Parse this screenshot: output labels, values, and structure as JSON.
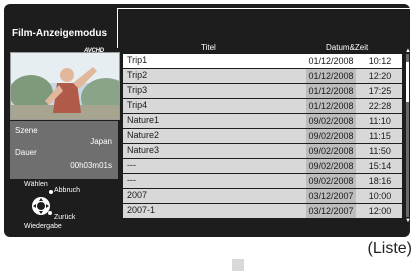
{
  "panel": {
    "title": "Film-Anzeigemodus",
    "badge": "AVCHD"
  },
  "info": {
    "scene_label": "Szene",
    "scene_value": "Japan",
    "duration_label": "Dauer",
    "duration_value": "00h03m01s"
  },
  "help": {
    "select": "Wählen",
    "cancel": "Abbruch",
    "back": "Zurück",
    "playback": "Wiedergabe"
  },
  "table": {
    "headers": {
      "title": "Titel",
      "datetime": "Datum&Zeit"
    },
    "selected_index": 0,
    "rows": [
      {
        "title": "Trip1",
        "date": "01/12/2008",
        "time": "10:12"
      },
      {
        "title": "Trip2",
        "date": "01/12/2008",
        "time": "12:20"
      },
      {
        "title": "Trip3",
        "date": "01/12/2008",
        "time": "17:25"
      },
      {
        "title": "Trip4",
        "date": "01/12/2008",
        "time": "22:28"
      },
      {
        "title": "Nature1",
        "date": "09/02/2008",
        "time": "11:10"
      },
      {
        "title": "Nature2",
        "date": "09/02/2008",
        "time": "11:15"
      },
      {
        "title": "Nature3",
        "date": "09/02/2008",
        "time": "11:50"
      },
      {
        "title": "---",
        "date": "09/02/2008",
        "time": "15:14"
      },
      {
        "title": "---",
        "date": "09/02/2008",
        "time": "18:16"
      },
      {
        "title": "2007",
        "date": "03/12/2007",
        "time": "10:00"
      },
      {
        "title": "2007-1",
        "date": "03/12/2007",
        "time": "12:00"
      }
    ]
  },
  "caption": "(Liste)"
}
